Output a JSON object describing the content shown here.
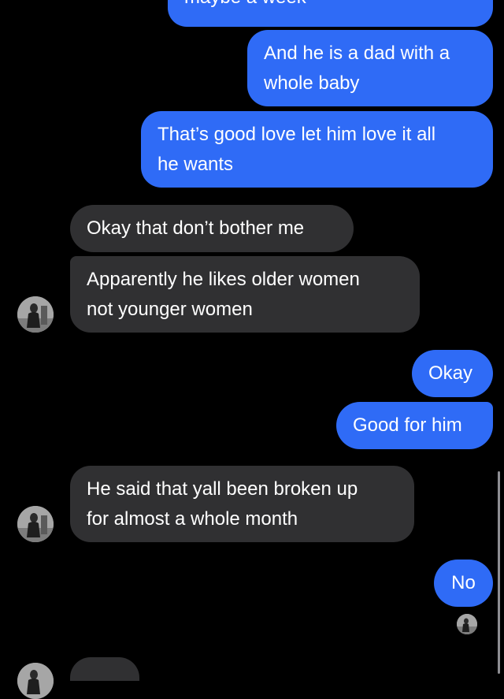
{
  "messages": [
    {
      "id": "m1",
      "direction": "outgoing",
      "text": "maybe a week"
    },
    {
      "id": "m2",
      "direction": "outgoing",
      "lines": [
        "And he is a dad with a",
        "whole baby"
      ]
    },
    {
      "id": "m3",
      "direction": "outgoing",
      "lines": [
        "That’s good love let him love it all",
        "he wants"
      ]
    },
    {
      "id": "m4",
      "direction": "incoming",
      "text": "Okay that don’t bother me"
    },
    {
      "id": "m5",
      "direction": "incoming",
      "lines": [
        "Apparently he likes older women",
        "not younger women"
      ]
    },
    {
      "id": "m6",
      "direction": "outgoing",
      "text": "Okay"
    },
    {
      "id": "m7",
      "direction": "outgoing",
      "text": "Good for him"
    },
    {
      "id": "m8",
      "direction": "incoming",
      "lines": [
        "He said that yall been broken up",
        "for almost a whole month"
      ]
    },
    {
      "id": "m9",
      "direction": "outgoing",
      "text": "No"
    }
  ],
  "theme": {
    "background": "#000000",
    "outgoing_bubble": "#2f6bf6",
    "incoming_bubble": "#303032",
    "text": "#ffffff"
  },
  "icons": {
    "contact_avatar": "contact-avatar-icon",
    "read_receipt": "read-receipt-avatar-icon"
  }
}
